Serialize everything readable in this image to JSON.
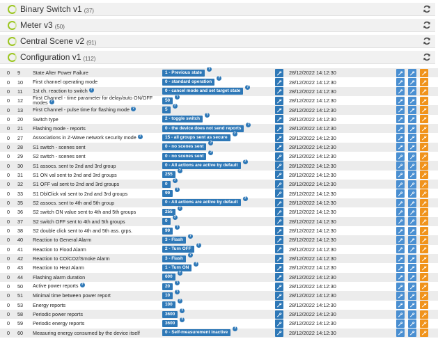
{
  "command_classes": [
    {
      "name": "Binary Switch v1",
      "count": "(37)"
    },
    {
      "name": "Meter v3",
      "count": "(50)"
    },
    {
      "name": "Central Scene v2",
      "count": "(91)"
    },
    {
      "name": "Configuration v1",
      "count": "(112)"
    }
  ],
  "icons": {
    "status": "loading-ring-icon",
    "refresh": "refresh-icon",
    "edit": "wrench-icon"
  },
  "colors": {
    "badge": "#2e78b7",
    "orange": "#f0931b",
    "ring": "#9bc61f"
  },
  "date": "28/12/2022 14:12:30",
  "rows": [
    {
      "inst": "0",
      "num": "9",
      "name": "State After Power Failure",
      "value": "1 - Previous state"
    },
    {
      "inst": "0",
      "num": "10",
      "name": "First channel operating mode",
      "value": "0 - standard operation"
    },
    {
      "inst": "0",
      "num": "11",
      "name": "1st ch. reaction to switch",
      "value": "0 - cancel mode and set target state"
    },
    {
      "inst": "0",
      "num": "12",
      "name": "First Channel - time parameter for delay/auto ON/OFF modes",
      "value": "50"
    },
    {
      "inst": "0",
      "num": "13",
      "name": "First Channel - pulse time for flashing mode",
      "value": "5"
    },
    {
      "inst": "0",
      "num": "20",
      "name": "Switch type",
      "value": "2 - toggle switch"
    },
    {
      "inst": "0",
      "num": "21",
      "name": "Flashing mode - reports",
      "value": "0 - the device does not send reports"
    },
    {
      "inst": "0",
      "num": "27",
      "name": "Associations in Z-Wave network security mode",
      "value": "15 - all groups sent as secure"
    },
    {
      "inst": "0",
      "num": "28",
      "name": "S1 switch - scenes sent",
      "value": "0 - no scenes sent"
    },
    {
      "inst": "0",
      "num": "29",
      "name": "S2 switch - scenes sent",
      "value": "0 - no scenes sent"
    },
    {
      "inst": "0",
      "num": "30",
      "name": "S1 assocs. sent to 2nd and 3rd group",
      "value": "0 - All actions are active by default"
    },
    {
      "inst": "0",
      "num": "31",
      "name": "S1 ON val sent to 2nd and 3rd groups",
      "value": "255"
    },
    {
      "inst": "0",
      "num": "32",
      "name": "S1 OFF val sent to 2nd and 3rd groups",
      "value": "0"
    },
    {
      "inst": "0",
      "num": "33",
      "name": "S1 DblClick val sent to 2nd and 3rd groups",
      "value": "99"
    },
    {
      "inst": "0",
      "num": "35",
      "name": "S2 assocs. sent to 4th and 5th group",
      "value": "0 - All actions are active by default"
    },
    {
      "inst": "0",
      "num": "36",
      "name": "S2 switch ON value sent to 4th and 5th groups",
      "value": "255"
    },
    {
      "inst": "0",
      "num": "37",
      "name": "S2 switch OFF sent to 4th and 5th groups",
      "value": "0"
    },
    {
      "inst": "0",
      "num": "38",
      "name": "S2 double click sent to 4th and 5th ass. grps.",
      "value": "99"
    },
    {
      "inst": "0",
      "num": "40",
      "name": "Reaction to General Alarm",
      "value": "3 - Flash"
    },
    {
      "inst": "0",
      "num": "41",
      "name": "Reaction to Flood Alarm",
      "value": "2 - Turn OFF"
    },
    {
      "inst": "0",
      "num": "42",
      "name": "Reaction to CO/CO2/Smoke Alarm",
      "value": "3 - Flash"
    },
    {
      "inst": "0",
      "num": "43",
      "name": "Reaction to Heat Alarm",
      "value": "1 - Turn ON"
    },
    {
      "inst": "0",
      "num": "44",
      "name": "Flashing alarm duration",
      "value": "600"
    },
    {
      "inst": "0",
      "num": "50",
      "name": "Active power reports",
      "value": "20"
    },
    {
      "inst": "0",
      "num": "51",
      "name": "Minimal time between power report",
      "value": "10"
    },
    {
      "inst": "0",
      "num": "53",
      "name": "Energy reports",
      "value": "100"
    },
    {
      "inst": "0",
      "num": "58",
      "name": "Periodic power reports",
      "value": "3600"
    },
    {
      "inst": "0",
      "num": "59",
      "name": "Periodic energy reports",
      "value": "3600"
    },
    {
      "inst": "0",
      "num": "60",
      "name": "Measuring energy consumed by the device itself",
      "value": "0 - Self-measurement inactive"
    }
  ]
}
